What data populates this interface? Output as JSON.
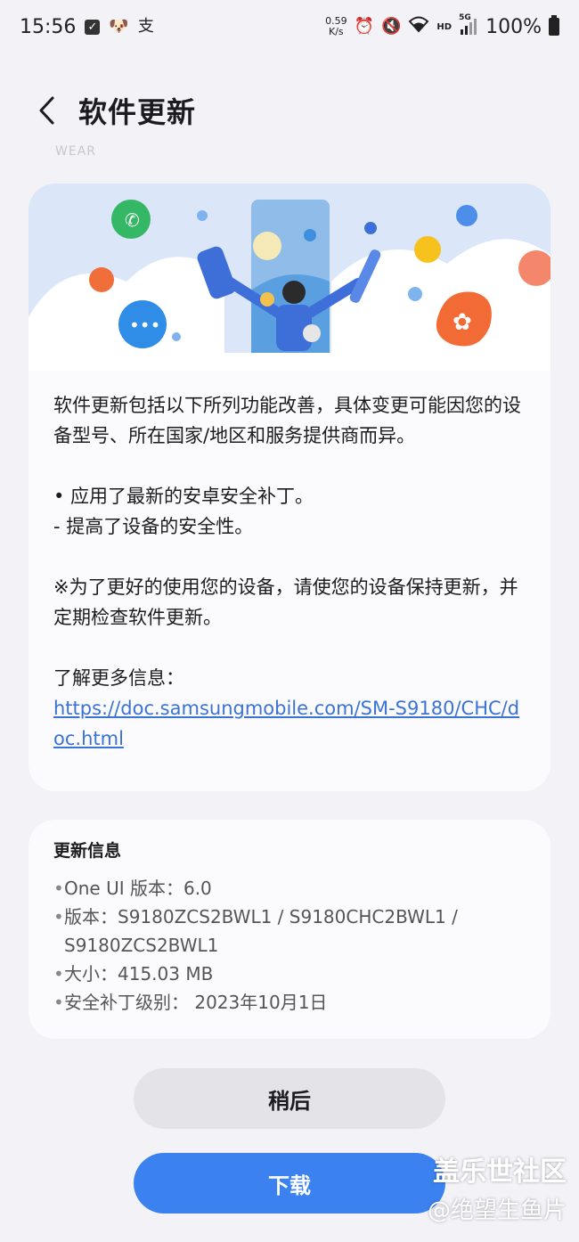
{
  "status_bar": {
    "time": "15:56",
    "notif_icon_2": "支",
    "speed_value": "0.59",
    "speed_unit": "K/s",
    "net_hd": "HD",
    "net_5g": "5G",
    "battery": "100%"
  },
  "header": {
    "title": "软件更新"
  },
  "faded_text": "WEAR",
  "description": {
    "intro": "软件更新包括以下所列功能改善，具体变更可能因您的设备型号、所在国家/地区和服务提供商而异。",
    "bullet": "• 应用了最新的安卓安全补丁。",
    "sub_bullet": " - 提高了设备的安全性。",
    "note": "※为了更好的使用您的设备，请使您的设备保持更新，并定期检查软件更新。",
    "more_label": "了解更多信息：",
    "link": "https://doc.samsungmobile.com/SM-S9180/CHC/doc.html"
  },
  "update_info": {
    "title": "更新信息",
    "items": [
      "One UI 版本：6.0",
      "版本：S9180ZCS2BWL1 / S9180CHC2BWL1 / S9180ZCS2BWL1",
      "大小：415.03 MB",
      "安全补丁级别： 2023年10月1日"
    ]
  },
  "buttons": {
    "later": "稍后",
    "download": "下载"
  },
  "watermark": {
    "line1": "盖乐世社区",
    "line2": "@绝望生鱼片"
  },
  "colors": {
    "background": "#f2f2f7",
    "card": "#fbfbfd",
    "link": "#3a73d6",
    "primary_button": "#3b82f0",
    "secondary_button": "#e3e3e8"
  }
}
